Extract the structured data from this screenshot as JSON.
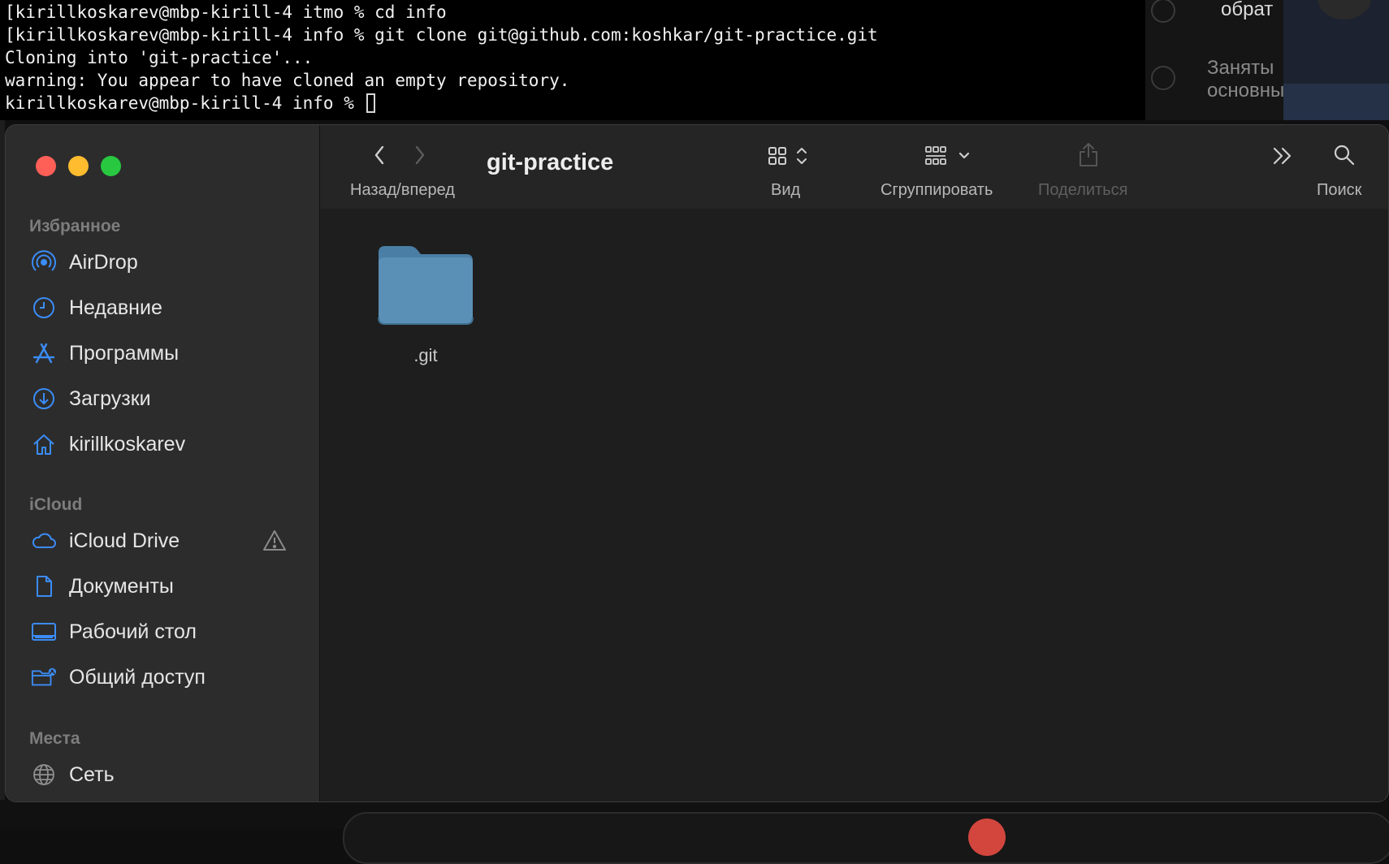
{
  "terminal": {
    "lines": [
      "[kirillkoskarev@mbp-kirill-4 itmo % cd info",
      "[kirillkoskarev@mbp-kirill-4 info % git clone git@github.com:koshkar/git-practice.git",
      "Cloning into 'git-practice'...",
      "warning: You appear to have cloned an empty repository.",
      "kirillkoskarev@mbp-kirill-4 info % "
    ]
  },
  "background_app": {
    "text_1": "обрат",
    "text_2": "Заняты",
    "text_3": "основны"
  },
  "finder": {
    "title": "git-practice",
    "toolbar": {
      "back_forward_label": "Назад/вперед",
      "view_label": "Вид",
      "group_label": "Сгруппировать",
      "share_label": "Поделиться",
      "search_label": "Поиск"
    },
    "sidebar": {
      "favorites_heading": "Избранное",
      "favorites": [
        {
          "label": "AirDrop",
          "icon": "airdrop-icon"
        },
        {
          "label": "Недавние",
          "icon": "clock-icon"
        },
        {
          "label": "Программы",
          "icon": "applications-icon"
        },
        {
          "label": "Загрузки",
          "icon": "downloads-icon"
        },
        {
          "label": "kirillkoskarev",
          "icon": "home-icon"
        }
      ],
      "icloud_heading": "iCloud",
      "icloud": [
        {
          "label": "iCloud Drive",
          "icon": "cloud-icon"
        },
        {
          "label": "Документы",
          "icon": "document-icon"
        },
        {
          "label": "Рабочий стол",
          "icon": "desktop-icon"
        },
        {
          "label": "Общий доступ",
          "icon": "shared-folder-icon"
        }
      ],
      "locations_heading": "Места",
      "locations": [
        {
          "label": "Сеть",
          "icon": "globe-icon"
        }
      ]
    },
    "items": [
      {
        "name": ".git",
        "icon": "folder-icon"
      }
    ]
  },
  "colors": {
    "accent": "#3b8cf6",
    "folder": "#4d7fa3",
    "close": "#fe5f57",
    "minimize": "#febc2e",
    "maximize": "#28c840"
  }
}
